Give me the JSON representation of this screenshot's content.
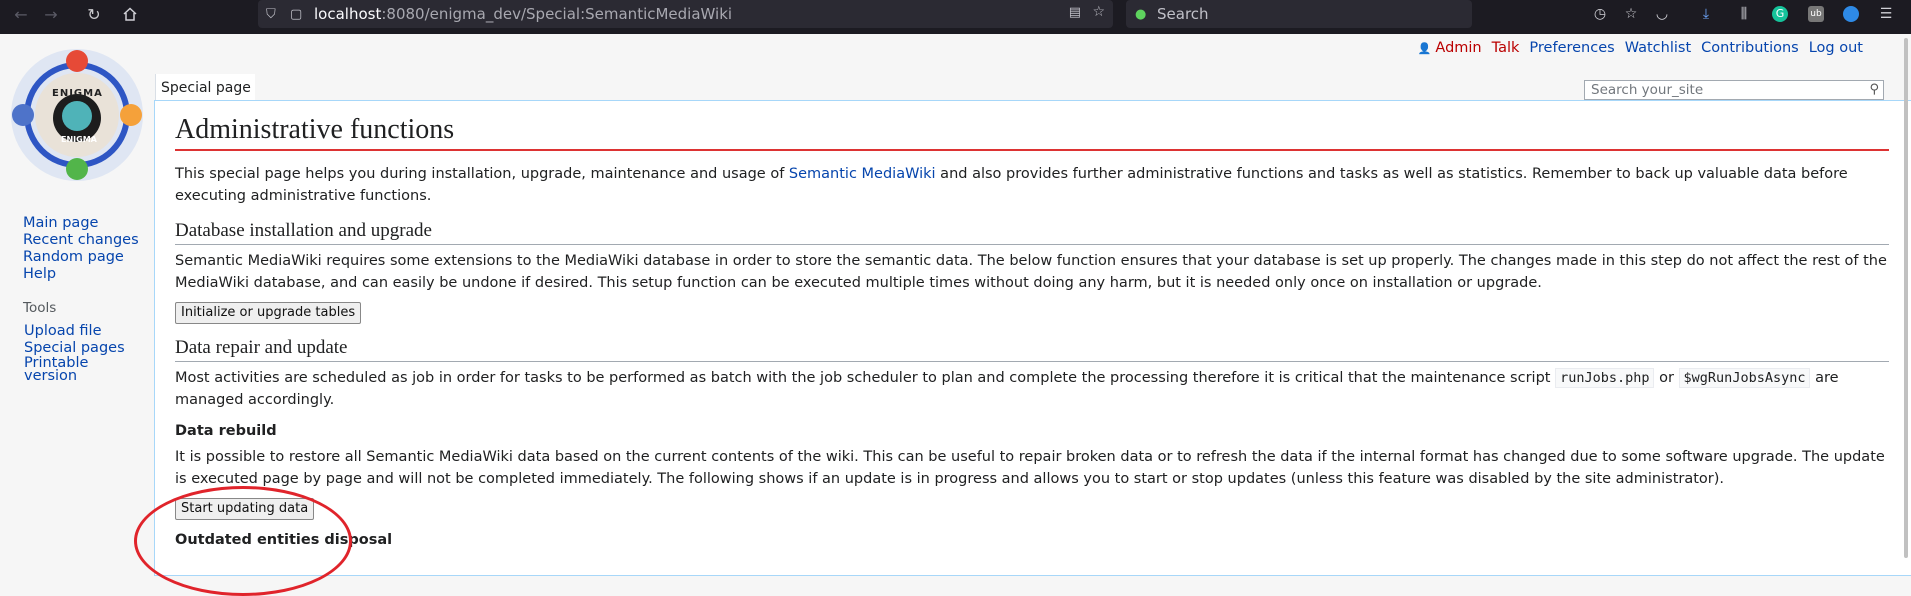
{
  "browser": {
    "url_host": "localhost",
    "url_path": ":8080/enigma_dev/Special:SemanticMediaWiki",
    "search_placeholder": "Search"
  },
  "user_menu": {
    "user": "Admin",
    "talk": "Talk",
    "preferences": "Preferences",
    "watchlist": "Watchlist",
    "contributions": "Contributions",
    "logout": "Log out"
  },
  "tab": {
    "label": "Special page"
  },
  "wiki_search": {
    "placeholder": "Search your_site"
  },
  "sidebar": {
    "nav": [
      "Main page",
      "Recent changes",
      "Random page",
      "Help"
    ],
    "tools_heading": "Tools",
    "tools": [
      "Upload file",
      "Special pages",
      "Printable version"
    ],
    "logo_top": "ENIGMA",
    "logo_bottom": "ENIGMA"
  },
  "content": {
    "title": "Administrative functions",
    "intro_before": "This special page helps you during installation, upgrade, maintenance and usage of ",
    "intro_link": "Semantic MediaWiki",
    "intro_after": " and also provides further administrative functions and tasks as well as statistics. Remember to back up valuable data before executing administrative functions.",
    "db_heading": "Database installation and upgrade",
    "db_text": "Semantic MediaWiki requires some extensions to the MediaWiki database in order to store the semantic data. The below function ensures that your database is set up properly. The changes made in this step do not affect the rest of the MediaWiki database, and can easily be undone if desired. This setup function can be executed multiple times without doing any harm, but it is needed only once on installation or upgrade.",
    "db_button": "Initialize or upgrade tables",
    "repair_heading": "Data repair and update",
    "repair_text_before": "Most activities are scheduled as job in order for tasks to be performed as batch with the job scheduler to plan and complete the processing therefore it is critical that the maintenance script ",
    "repair_code1": "runJobs.php",
    "repair_text_mid": " or ",
    "repair_code2": "$wgRunJobsAsync",
    "repair_text_after": " are managed accordingly.",
    "rebuild_heading": "Data rebuild",
    "rebuild_text": "It is possible to restore all Semantic MediaWiki data based on the current contents of the wiki. This can be useful to repair broken data or to refresh the data if the internal format has changed due to some software upgrade. The update is executed page by page and will not be completed immediately. The following shows if an update is in progress and allows you to start or stop updates (unless this feature was disabled by the site administrator).",
    "rebuild_button": "Start updating data",
    "next_heading": "Outdated entities disposal"
  }
}
